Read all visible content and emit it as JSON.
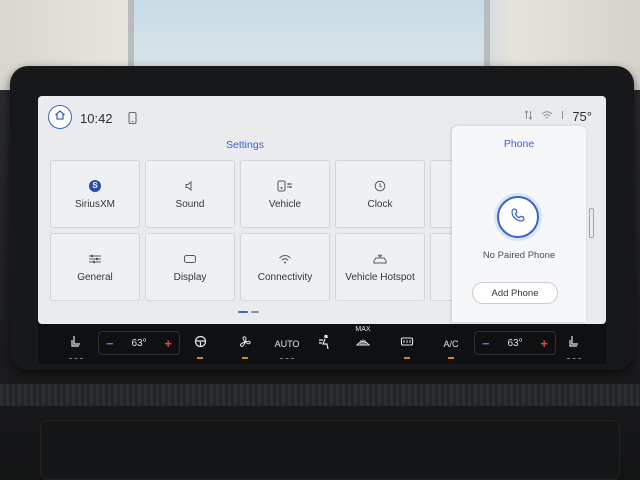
{
  "status": {
    "time": "10:42",
    "outside_temp": "75°"
  },
  "settings": {
    "title": "Settings",
    "tiles": [
      {
        "label": "SiriusXM",
        "icon": "siriusxm-icon"
      },
      {
        "label": "Sound",
        "icon": "speaker-icon"
      },
      {
        "label": "Vehicle",
        "icon": "vehicle-settings-icon"
      },
      {
        "label": "Clock",
        "icon": "clock-icon"
      },
      {
        "label": "General",
        "icon": "sliders-icon"
      },
      {
        "label": "Display",
        "icon": "display-icon"
      },
      {
        "label": "Connectivity",
        "icon": "wifi-icon"
      },
      {
        "label": "Vehicle Hotspot",
        "icon": "hotspot-car-icon"
      }
    ],
    "sxm_badge": "S"
  },
  "phone": {
    "title": "Phone",
    "status": "No Paired Phone",
    "add_button": "Add Phone"
  },
  "climate": {
    "driver_temp": "63°",
    "passenger_temp": "63°",
    "minus_symbol": "−",
    "plus_symbol": "+",
    "auto_label": "AUTO",
    "max_label": "MAX",
    "ac_label": "A/C"
  },
  "colors": {
    "accent": "#3a64c8",
    "screen_bg": "#e9ebee",
    "climate_bar": "#0f1011",
    "heat_red": "#e64646",
    "cool_blue": "#4b7be6",
    "indicator_orange": "#e87a1e"
  }
}
